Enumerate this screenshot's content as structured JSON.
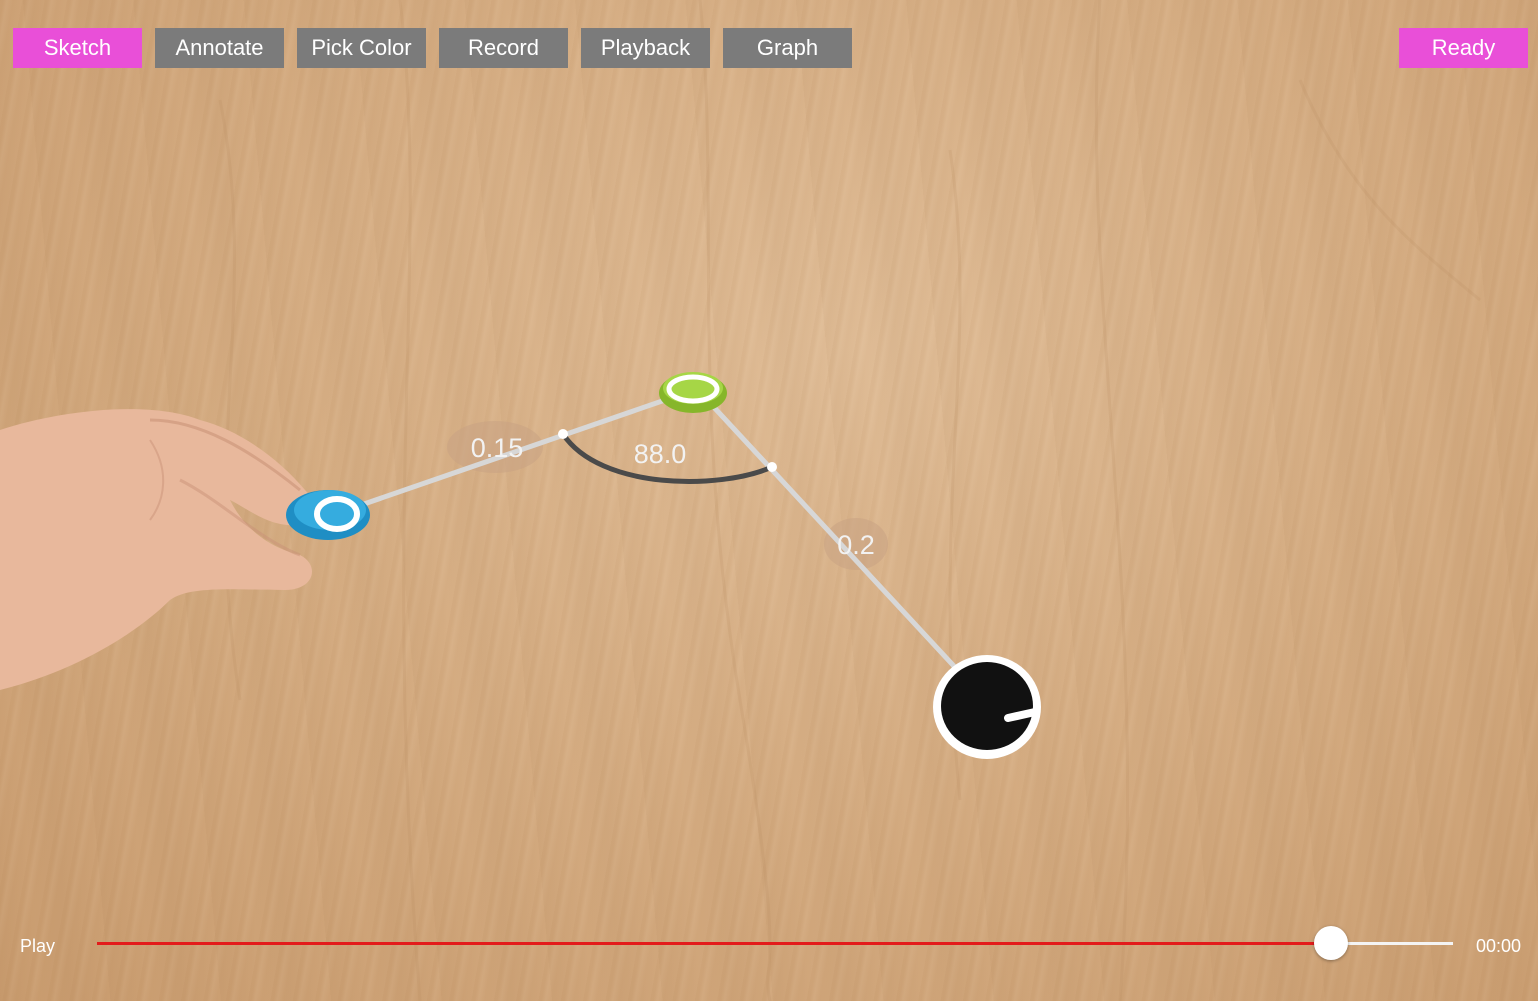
{
  "toolbar": {
    "buttons": [
      {
        "label": "Sketch",
        "active": true
      },
      {
        "label": "Annotate",
        "active": false
      },
      {
        "label": "Pick Color",
        "active": false
      },
      {
        "label": "Record",
        "active": false
      },
      {
        "label": "Playback",
        "active": false
      },
      {
        "label": "Graph",
        "active": false
      }
    ],
    "status_label": "Ready"
  },
  "colors": {
    "active_button": "#e94fd8",
    "inactive_button": "#7b7b7b",
    "timeline_played": "#e31b1b",
    "timeline_remaining": "#f4f4f4"
  },
  "scene": {
    "measurements": {
      "distance_left": "0.15",
      "angle": "88.0",
      "distance_right": "0.2"
    },
    "markers": [
      {
        "name": "blue-marker",
        "color": "#2a9fd6"
      },
      {
        "name": "green-marker",
        "color": "#9fd13a"
      },
      {
        "name": "black-marker",
        "color": "#111111"
      }
    ]
  },
  "playback": {
    "play_label": "Play",
    "time": "00:00",
    "progress": 0.91
  }
}
